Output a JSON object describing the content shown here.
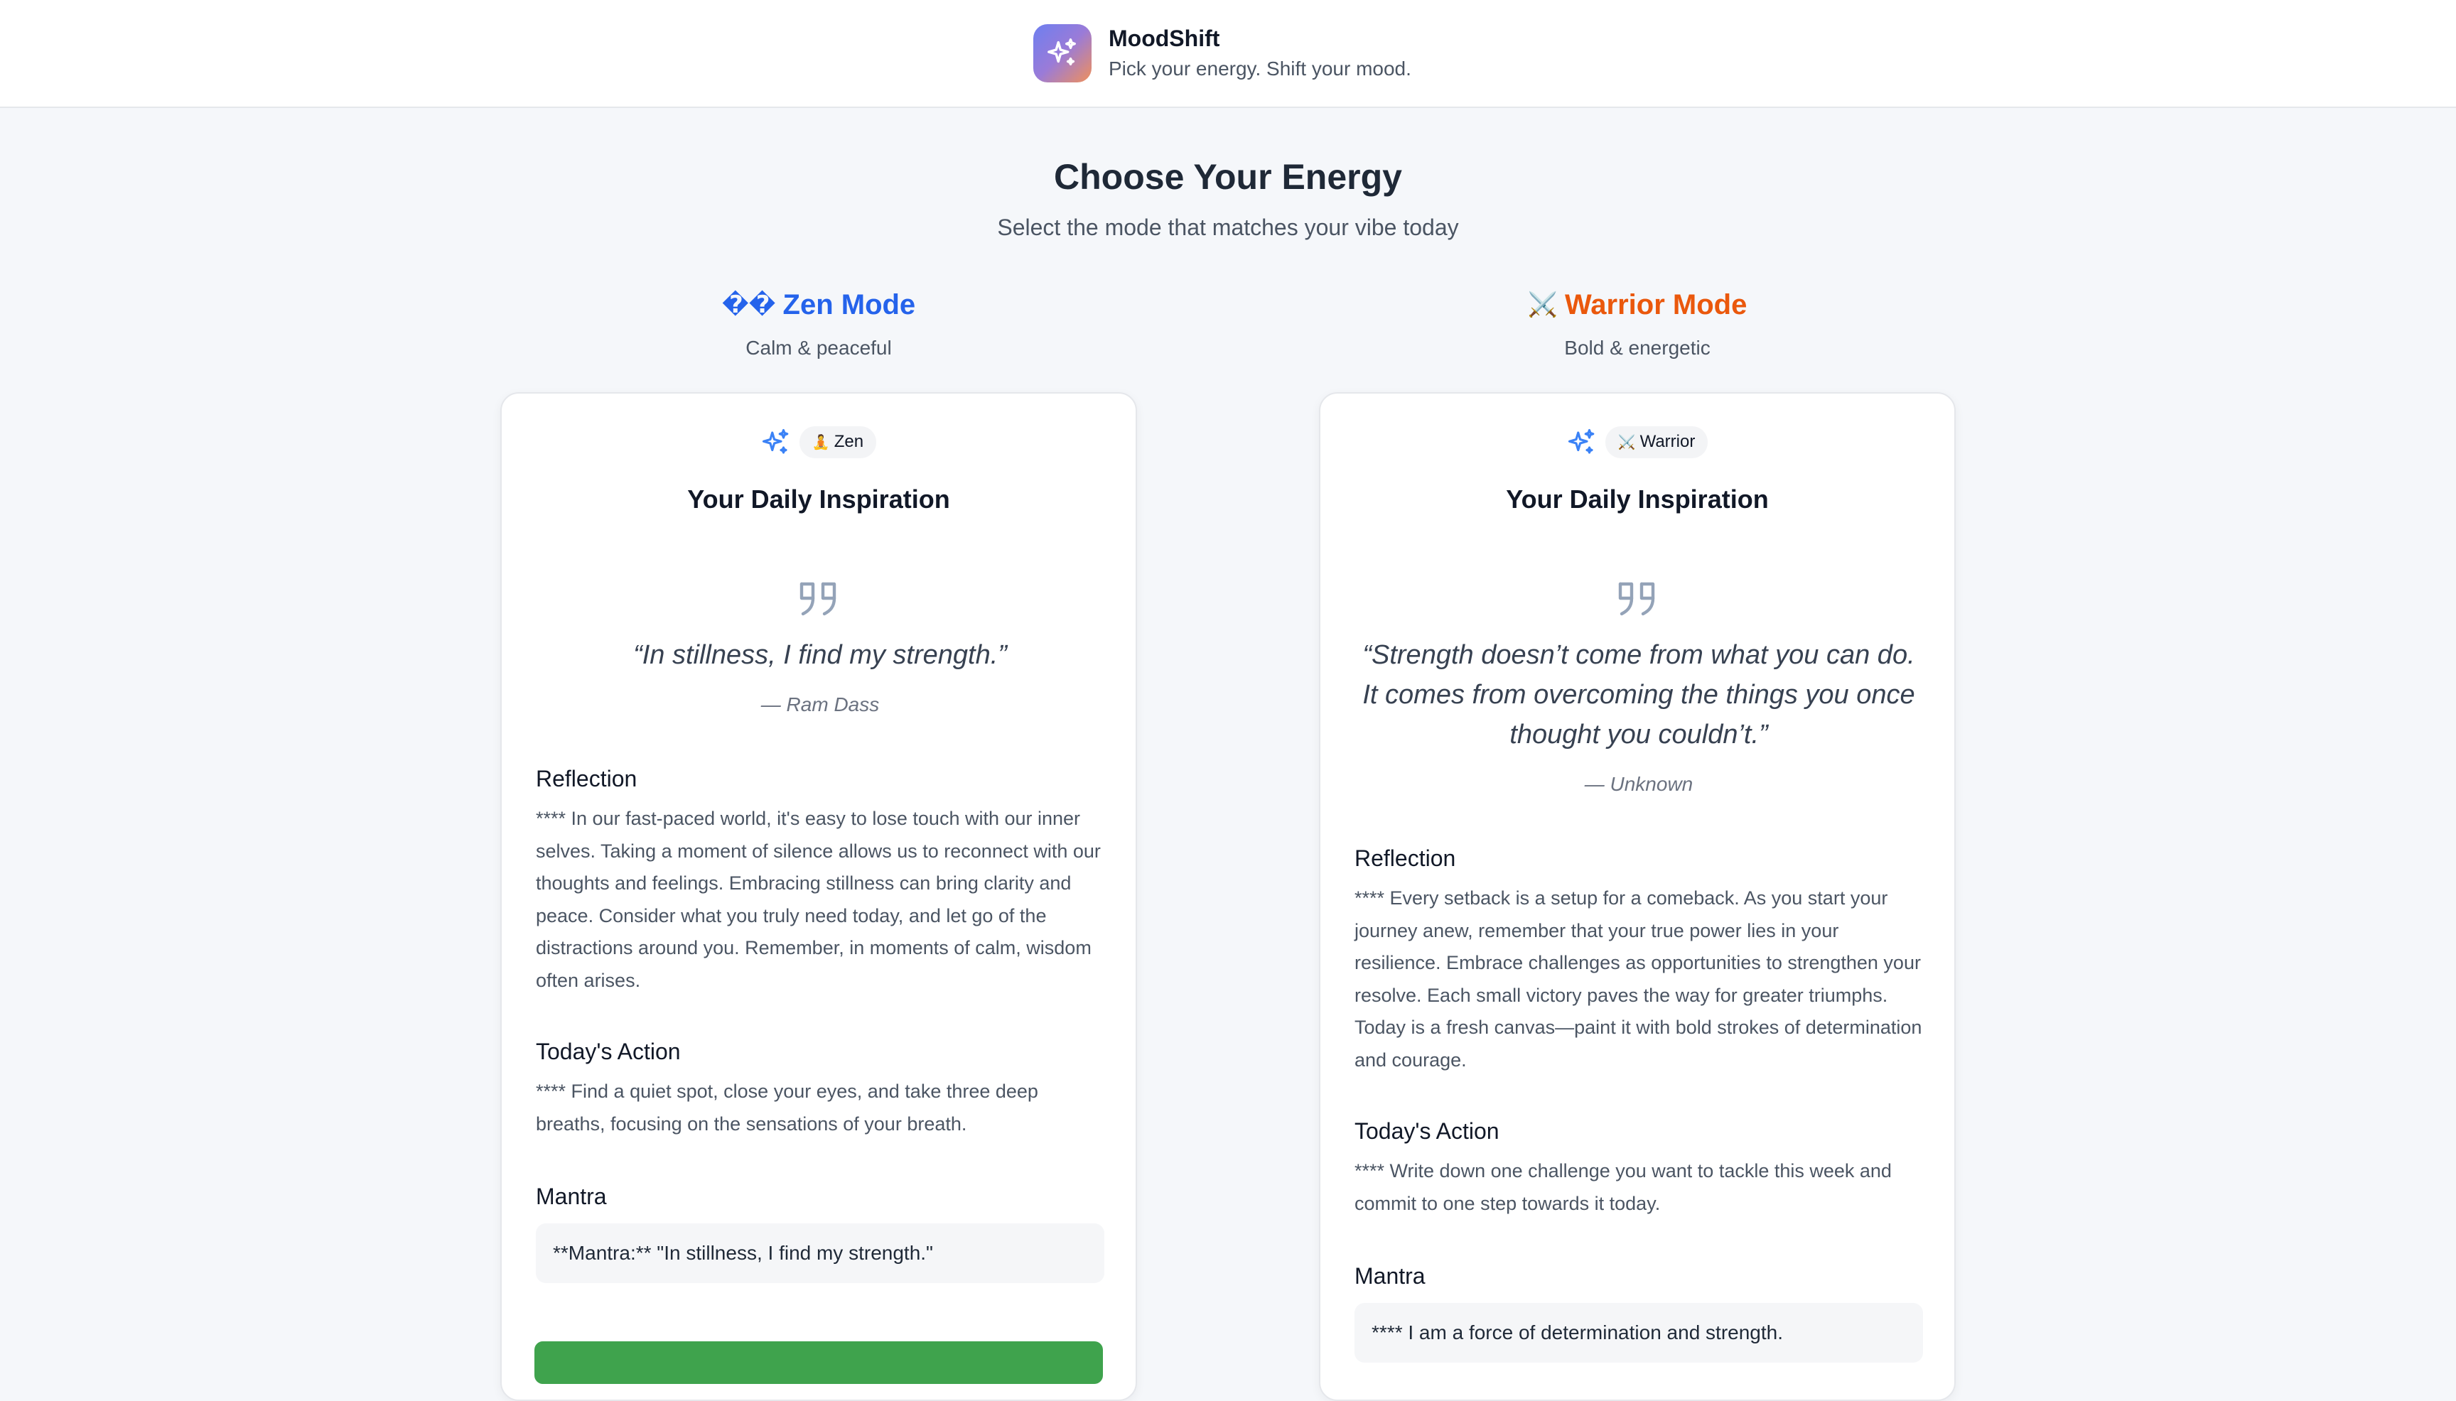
{
  "app": {
    "title": "MoodShift",
    "tagline": "Pick your energy. Shift your mood.",
    "logo_icon": "sparkles-icon",
    "logo_gradient": [
      "#6d7ff0",
      "#f0905a"
    ]
  },
  "page": {
    "title": "Choose Your Energy",
    "subtitle": "Select the mode that matches your vibe today"
  },
  "modes": [
    {
      "key": "zen",
      "heading_glyph": "��",
      "heading": "Zen Mode",
      "tagline": "Calm & peaceful",
      "accent": "#2563eb",
      "badge_icon": "🧘",
      "badge": "Zen",
      "card_title": "Your Daily Inspiration",
      "quote": "“In stillness, I find my strength.”",
      "author": "— Ram Dass",
      "reflection_title": "Reflection",
      "reflection": "**** In our fast-paced world, it's easy to lose touch with our inner selves. Taking a moment of silence allows us to reconnect with our thoughts and feelings. Embracing stillness can bring clarity and peace. Consider what you truly need today, and let go of the distractions around you. Remember, in moments of calm, wisdom often arises.",
      "action_title": "Today's Action",
      "action": "**** Find a quiet spot, close your eyes, and take three deep breaths, focusing on the sensations of your breath.",
      "mantra_title": "Mantra",
      "mantra": "**Mantra:** \"In stillness, I find my strength.\"",
      "cta_color": "#3fa34d"
    },
    {
      "key": "warrior",
      "heading_glyph": "⚔️",
      "heading": "Warrior Mode",
      "tagline": "Bold & energetic",
      "accent": "#ea580c",
      "badge_icon": "⚔️",
      "badge": "Warrior",
      "card_title": "Your Daily Inspiration",
      "quote": "“Strength doesn’t come from what you can do. It comes from overcoming the things you once thought you couldn’t.”",
      "author": "— Unknown",
      "reflection_title": "Reflection",
      "reflection": "**** Every setback is a setup for a comeback. As you start your journey anew, remember that your true power lies in your resilience. Embrace challenges as opportunities to strengthen your resolve. Each small victory paves the way for greater triumphs. Today is a fresh canvas—paint it with bold strokes of determination and courage.",
      "action_title": "Today's Action",
      "action": "**** Write down one challenge you want to tackle this week and commit to one step towards it today.",
      "mantra_title": "Mantra",
      "mantra": "**** I am a force of determination and strength."
    }
  ]
}
